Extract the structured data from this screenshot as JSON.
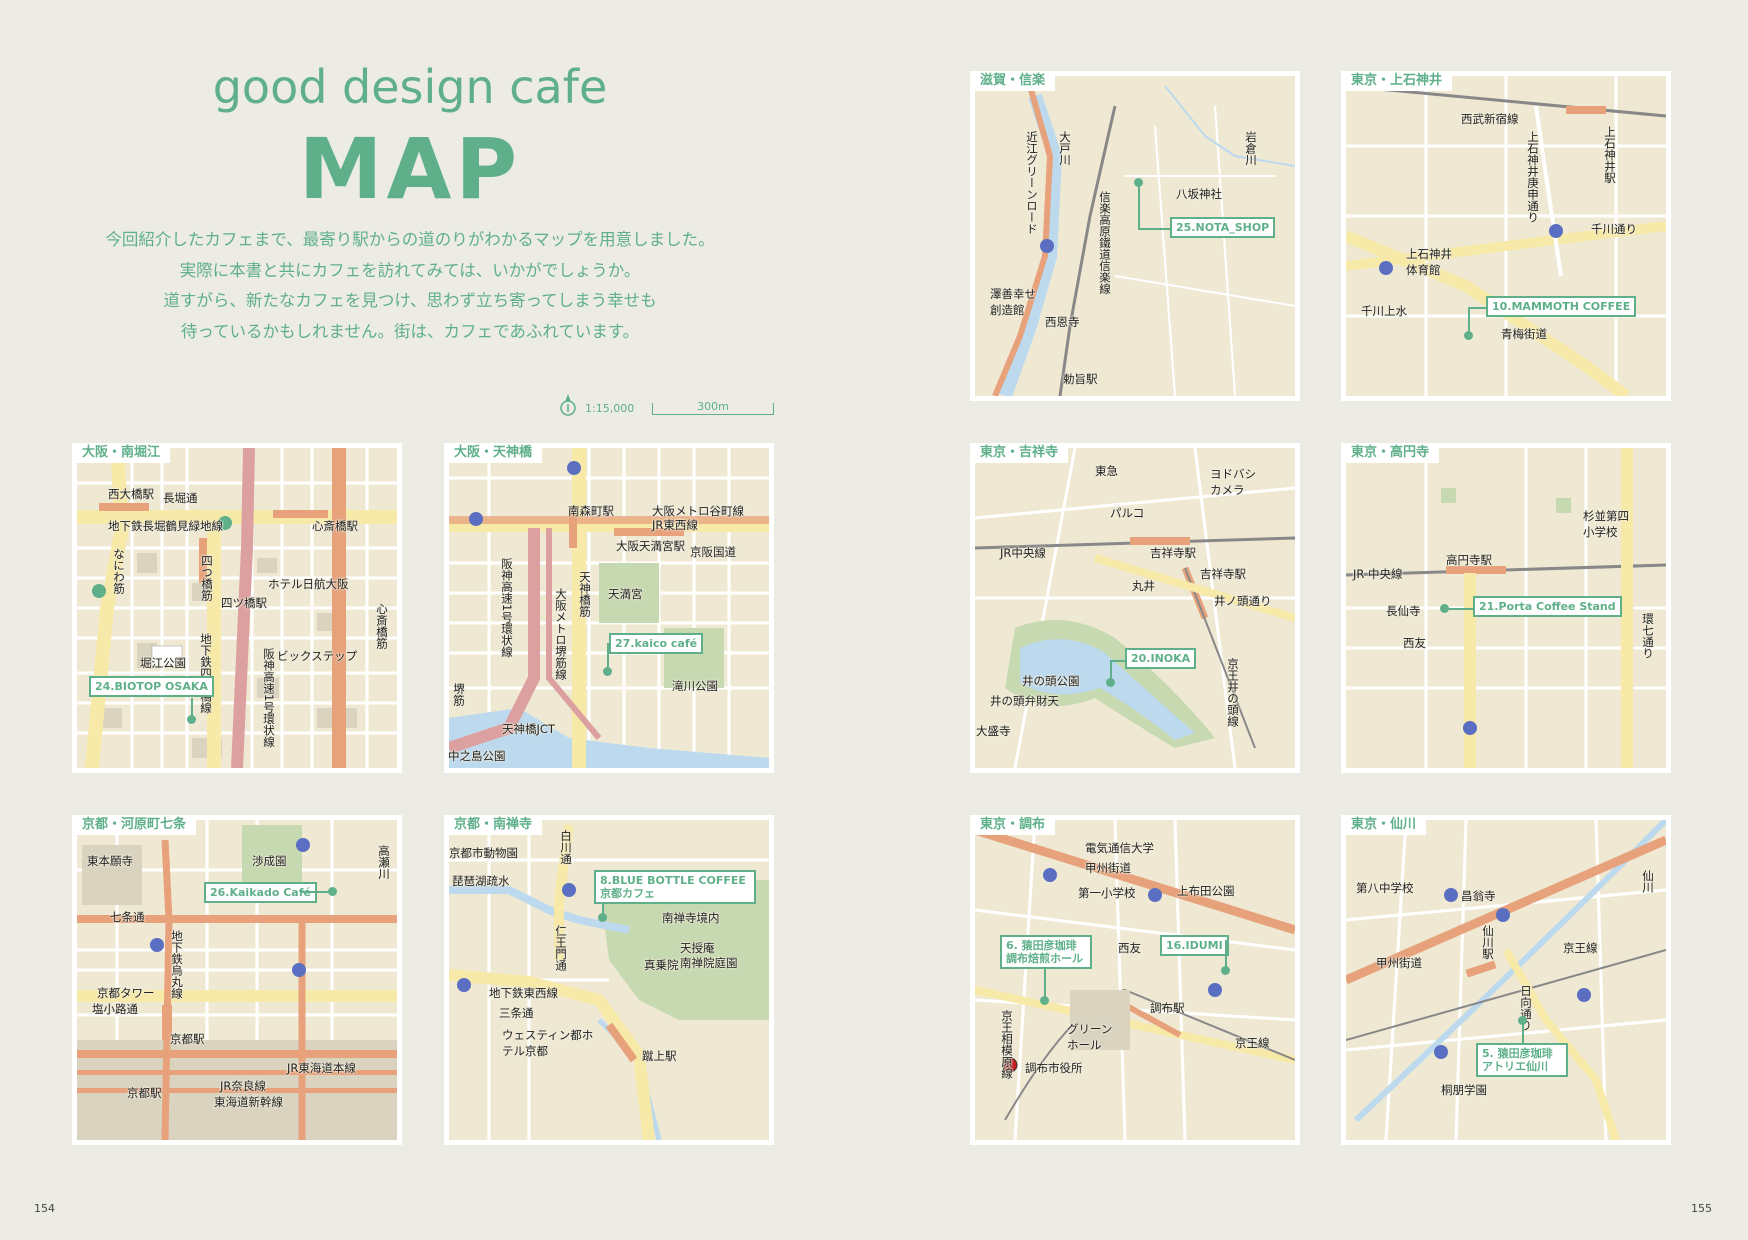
{
  "header": {
    "title_en": "good design cafe",
    "title_map": "MAP",
    "intro": [
      "今回紹介したカフェまで、最寄り駅からの道のりがわかるマップを用意しました。",
      "実際に本書と共にカフェを訪れてみては、いかがでしょうか。",
      "道すがら、新たなカフェを見つけ、思わず立ち寄ってしまう幸せも",
      "待っているかもしれません。街は、カフェであふれています。"
    ],
    "scale_text": "1:15,000",
    "scale_bar": "300m"
  },
  "pages": {
    "left": "154",
    "right": "155"
  },
  "colors": {
    "accent": "#5fb08a",
    "map_bg": "#efe9d4",
    "road": "#ffffff",
    "main_road": "#f7e9a8",
    "rail": "#e7a27c",
    "park": "#c7d9b0",
    "water": "#bcd9ee"
  },
  "maps": [
    {
      "id": "minamihorie",
      "title": "大阪・南堀江",
      "cafe": "24.BIOTOP OSAKA",
      "labels": [
        "西大橋駅",
        "長堀通",
        "地下鉄長堀鶴見緑地線",
        "心斎橋駅",
        "なにわ筋",
        "四つ橋筋",
        "ホテル日航大阪",
        "四ツ橋駅",
        "堀江公園",
        "地下鉄四つ橋線",
        "ビックステップ",
        "阪神高速1号環状線",
        "心斎橋筋"
      ],
      "route_signs": [
        "173",
        "41"
      ]
    },
    {
      "id": "tenjinbashi",
      "title": "大阪・天神橋",
      "cafe": "27.kaico café",
      "labels": [
        "南森町駅",
        "大阪メトロ谷町線",
        "JR東西線",
        "大阪天満宮駅",
        "京阪国道",
        "阪神高速1号環状線",
        "天神橋筋",
        "大阪メトロ堺筋線",
        "天満宮",
        "滝川公園",
        "堺筋",
        "天神橋JCT",
        "中之島公園"
      ],
      "route_signs": [
        "1",
        "14"
      ]
    },
    {
      "id": "kawaramachi",
      "title": "京都・河原町七条",
      "cafe": "26.Kaikado Café",
      "labels": [
        "東本願寺",
        "渉成園",
        "高瀬川",
        "七条通",
        "地下鉄烏丸線",
        "京都タワー",
        "塩小路通",
        "京都駅",
        "JR東海道本線",
        "JR奈良線",
        "東海道新幹線",
        "京都駅"
      ],
      "route_signs": [
        "32",
        "24",
        "115"
      ]
    },
    {
      "id": "nanzenji",
      "title": "京都・南禅寺",
      "cafe": "8.BLUE BOTTLE COFFEE 京都カフェ",
      "labels": [
        "京都市動物園",
        "白川通",
        "琵琶湖疏水",
        "南禅寺境内",
        "仁王門通",
        "天授庵",
        "南禅院庭園",
        "真乗院",
        "地下鉄東西線",
        "三条通",
        "ウェスティン都ホテル京都",
        "蹴上駅"
      ],
      "route_signs": [
        "143"
      ]
    },
    {
      "id": "shigaraki",
      "title": "滋賀・信楽",
      "cafe": "25.NOTA_SHOP",
      "labels": [
        "大戸川",
        "近江グリーンロード",
        "岩倉川",
        "八坂神社",
        "信楽高原鐵道信楽線",
        "澤善幸せ創造館",
        "西恩寺",
        "勅旨駅"
      ],
      "route_signs": [
        "307"
      ]
    },
    {
      "id": "kamishakujii",
      "title": "東京・上石神井",
      "cafe": "10.MAMMOTH COFFEE",
      "labels": [
        "西武新宿線",
        "上石神井庚申通り",
        "上石神井駅",
        "千川通り",
        "上石神井体育館",
        "千川上水",
        "青梅街道"
      ],
      "route_signs": [
        "4",
        "413"
      ]
    },
    {
      "id": "kichijoji",
      "title": "東京・吉祥寺",
      "cafe": "20.INOKA",
      "labels": [
        "東急",
        "ヨドバシカメラ",
        "パルコ",
        "JR中央線",
        "吉祥寺駅",
        "丸井",
        "吉祥寺駅",
        "井ノ頭通り",
        "井の頭公園",
        "井の頭弁財天",
        "京王井の頭線",
        "大盛寺"
      ],
      "route_signs": []
    },
    {
      "id": "koenji",
      "title": "東京・高円寺",
      "cafe": "21.Porta Coffee Stand",
      "labels": [
        "杉並第四小学校",
        "JR 中央線",
        "高円寺駅",
        "長仙寺",
        "西友",
        "環七通り"
      ],
      "route_signs": [
        "318"
      ]
    },
    {
      "id": "chofu",
      "title": "東京・調布",
      "cafe_1": "6. 猿田彦珈琲 調布焙煎ホール",
      "cafe_2": "16.IDUMI",
      "labels": [
        "電気通信大学",
        "甲州街道",
        "上布田公園",
        "第一小学校",
        "西友",
        "調布駅",
        "グリーンホール",
        "京王相模原線",
        "京王線",
        "調布市役所"
      ],
      "route_signs": [
        "12",
        "20",
        "119"
      ]
    },
    {
      "id": "sengawa",
      "title": "東京・仙川",
      "cafe": "5. 猿田彦珈琲 アトリエ仙川",
      "labels": [
        "第八中学校",
        "昌翁寺",
        "仙川",
        "甲州街道",
        "仙川駅",
        "京王線",
        "日向通り",
        "桐朋学園"
      ],
      "route_signs": [
        "114",
        "20",
        "114",
        "114"
      ]
    }
  ]
}
